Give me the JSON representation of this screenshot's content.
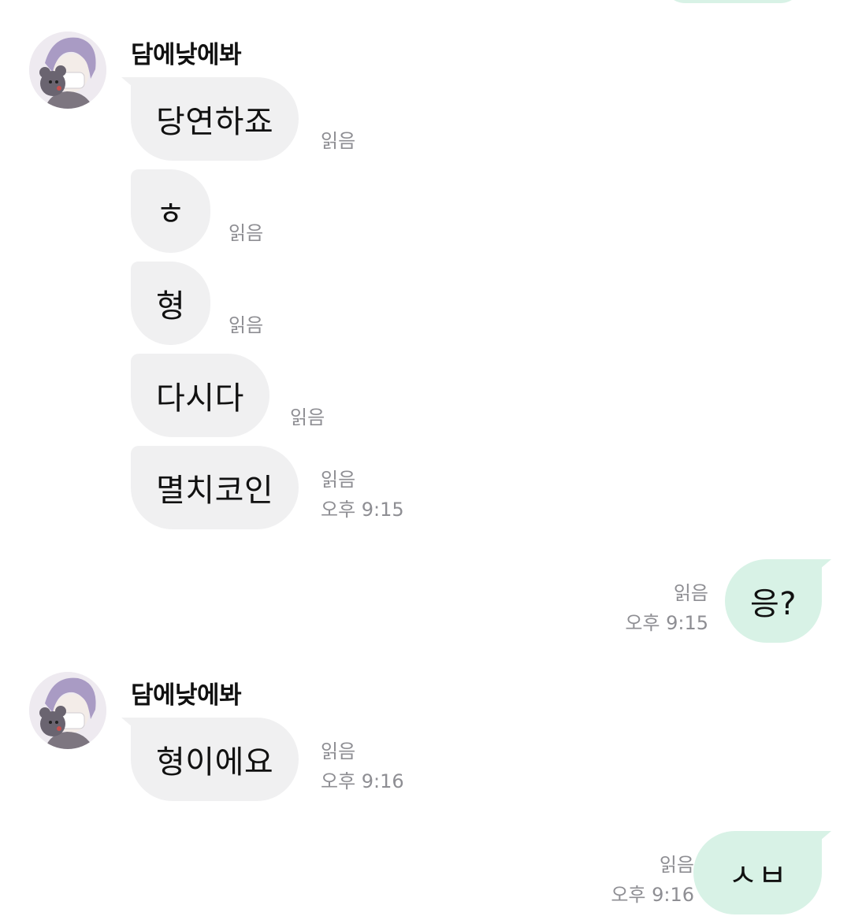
{
  "colors": {
    "incoming_bubble": "#f0f0f1",
    "outgoing_bubble": "#d8f2e6",
    "meta_text": "#8e8e93",
    "background": "#ffffff"
  },
  "groups": [
    {
      "sender": "담에낮에봐",
      "avatar_icon": "profile-avatar",
      "messages": [
        {
          "text": "당연하죠",
          "read": "읽음",
          "time": ""
        },
        {
          "text": "ㅎ",
          "read": "읽음",
          "time": ""
        },
        {
          "text": "형",
          "read": "읽음",
          "time": ""
        },
        {
          "text": "다시다",
          "read": "읽음",
          "time": ""
        },
        {
          "text": "멸치코인",
          "read": "읽음",
          "time": "오후 9:15"
        }
      ]
    },
    {
      "outgoing": true,
      "messages": [
        {
          "text": "응?",
          "read": "읽음",
          "time": "오후 9:15"
        }
      ]
    },
    {
      "sender": "담에낮에봐",
      "avatar_icon": "profile-avatar",
      "messages": [
        {
          "text": "형이에요",
          "read": "읽음",
          "time": "오후 9:16"
        }
      ]
    },
    {
      "outgoing": true,
      "messages": [
        {
          "text": "ㅅㅂ",
          "read": "읽음",
          "time": "오후 9:16"
        }
      ]
    }
  ]
}
